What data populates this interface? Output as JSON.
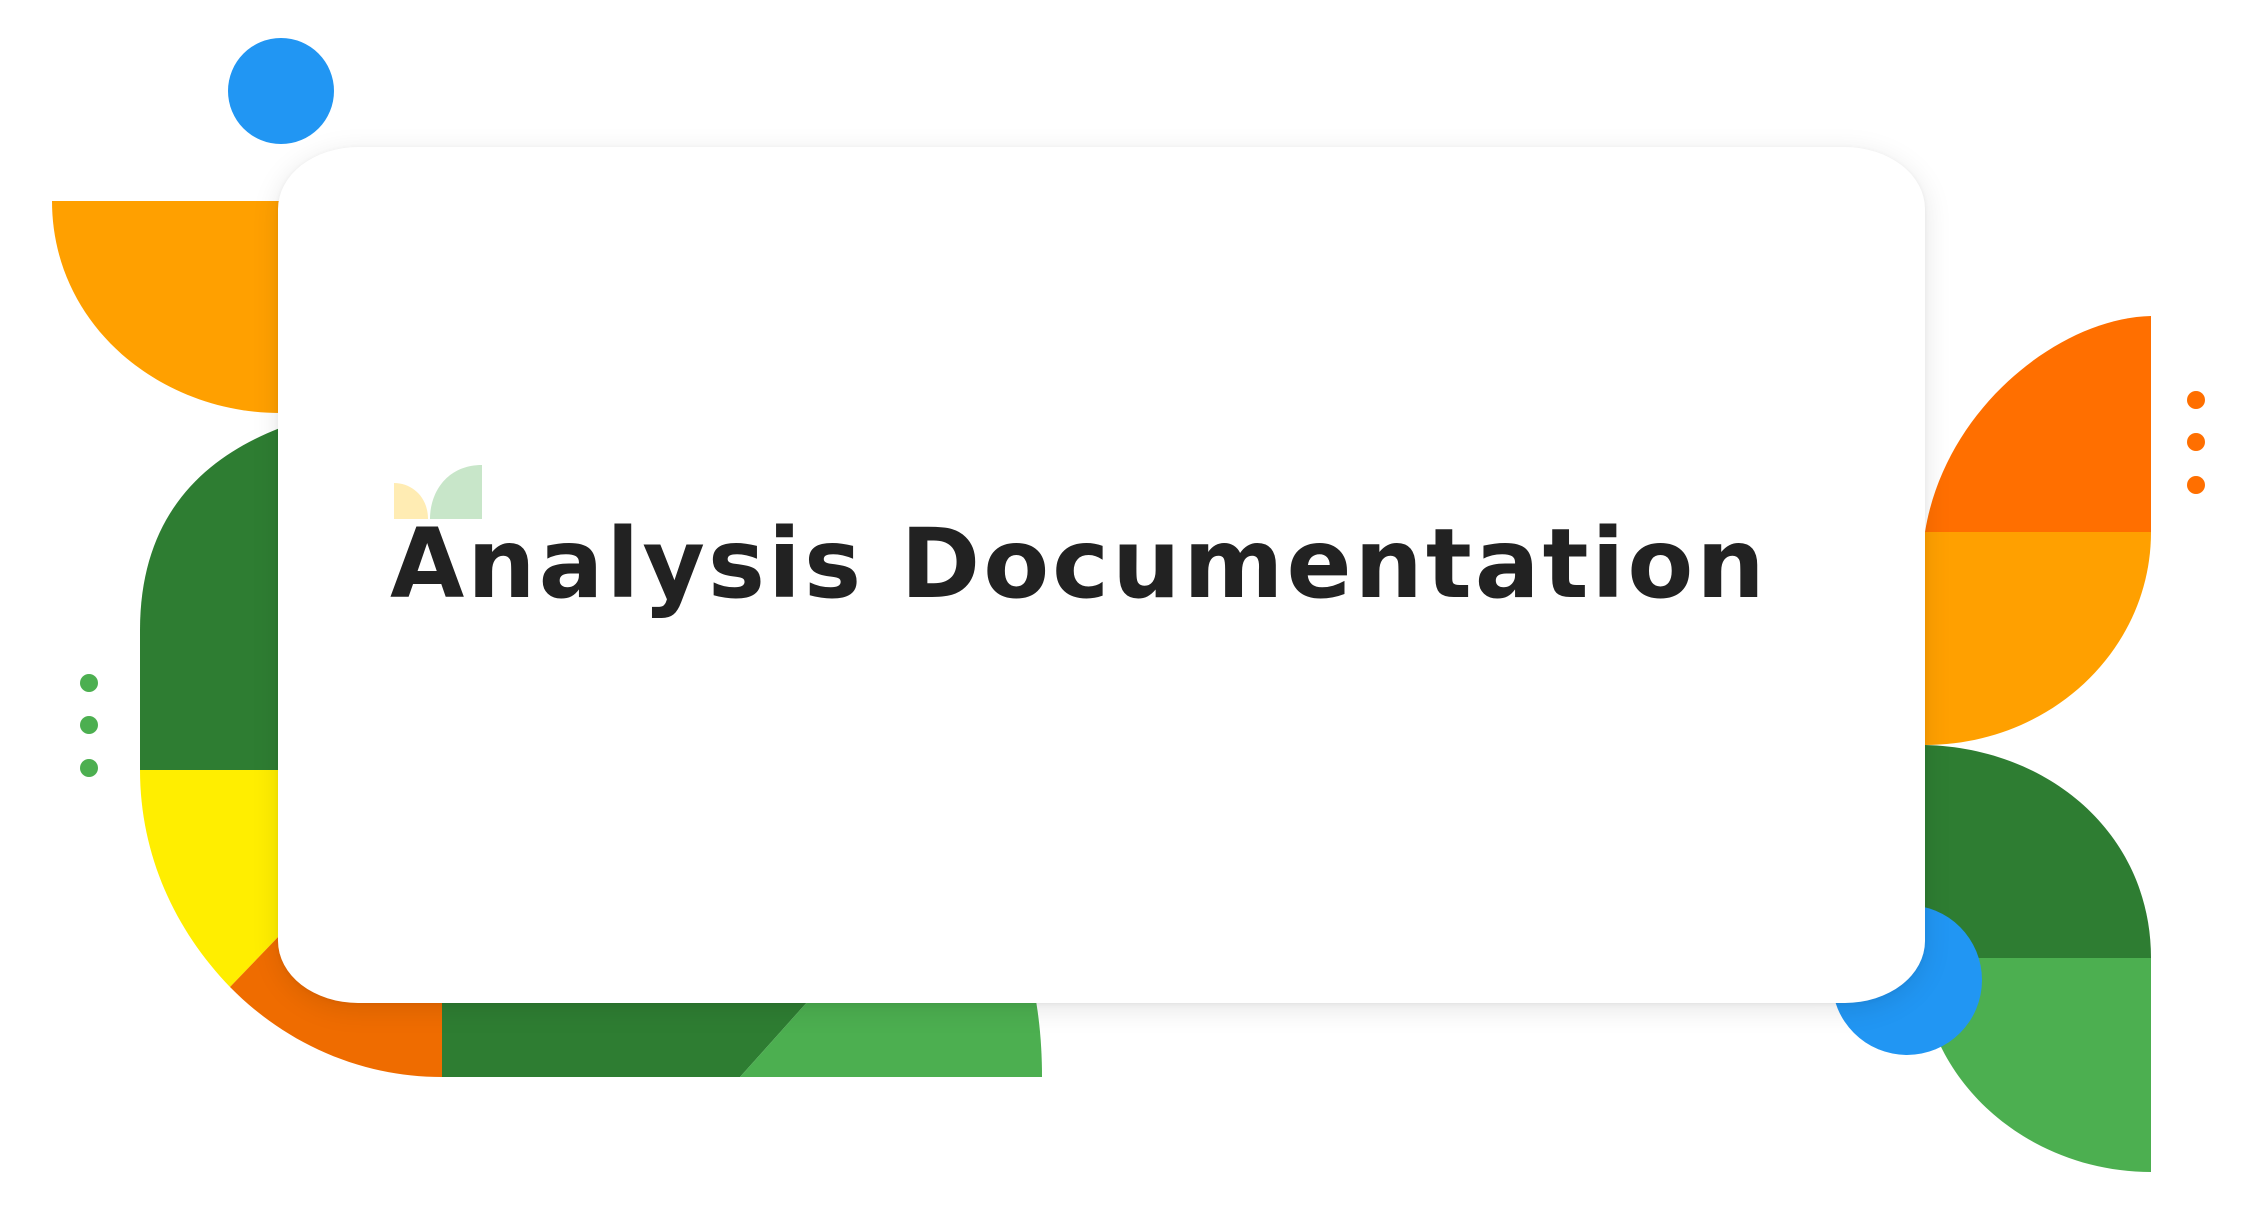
{
  "title": "Analysis Documentation",
  "colors": {
    "orange": "#FFA000",
    "dark_orange": "#FF6F00",
    "deep_orange": "#EF6C00",
    "dark_green": "#2E7D32",
    "green": "#4CAF50",
    "yellow": "#FFEE00",
    "blue": "#2196F3",
    "logo_yellow": "#FFECB3",
    "logo_green": "#C8E6C9",
    "text": "#222222"
  },
  "icons": [
    "decorative-blue-dot",
    "dot-column",
    "leaf-logo-icon"
  ]
}
